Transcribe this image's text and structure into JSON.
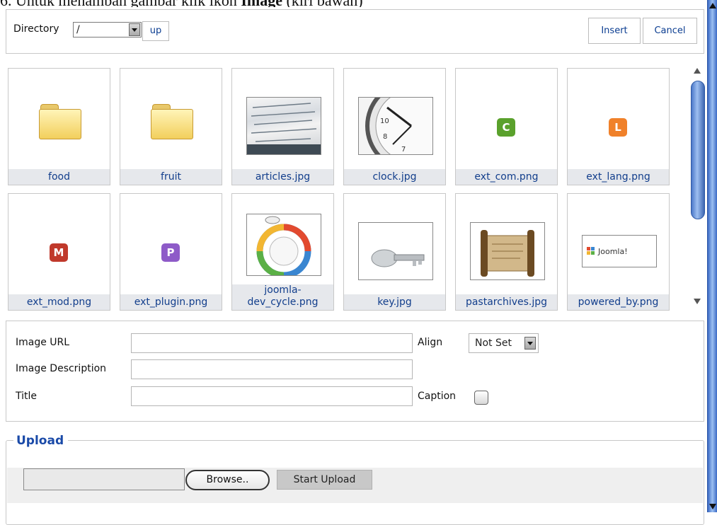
{
  "doc": {
    "prefix": "6.   Untuk menambah gambar klik ikon ",
    "bold": "Image",
    "suffix": " (kiri bawah)"
  },
  "toolbar": {
    "directory_label": "Directory",
    "directory_value": "/",
    "up_label": "up",
    "insert_label": "Insert",
    "cancel_label": "Cancel"
  },
  "files": [
    {
      "name": "food",
      "kind": "folder"
    },
    {
      "name": "fruit",
      "kind": "folder"
    },
    {
      "name": "articles.jpg",
      "kind": "photo",
      "icon": "articles-thumbnail"
    },
    {
      "name": "clock.jpg",
      "kind": "photo",
      "icon": "clock-thumbnail"
    },
    {
      "name": "ext_com.png",
      "kind": "badge",
      "letter": "C",
      "color": "#5aa12c"
    },
    {
      "name": "ext_lang.png",
      "kind": "badge",
      "letter": "L",
      "color": "#f0812a"
    },
    {
      "name": "ext_mod.png",
      "kind": "badge",
      "letter": "M",
      "color": "#c0392b"
    },
    {
      "name": "ext_plugin.png",
      "kind": "badge",
      "letter": "P",
      "color": "#8e5bc8"
    },
    {
      "name": "joomla-dev_cycle.png",
      "kind": "photo",
      "icon": "cycle-diagram-thumbnail"
    },
    {
      "name": "key.jpg",
      "kind": "photo",
      "icon": "key-thumbnail"
    },
    {
      "name": "pastarchives.jpg",
      "kind": "photo",
      "icon": "scroll-thumbnail"
    },
    {
      "name": "powered_by.png",
      "kind": "photo",
      "icon": "joomla-logo-thumbnail"
    }
  ],
  "thumb_text": {
    "powered_by": "Joomla!"
  },
  "form": {
    "image_url_label": "Image URL",
    "image_url_value": "",
    "description_label": "Image Description",
    "description_value": "",
    "title_label": "Title",
    "title_value": "",
    "align_label": "Align",
    "align_value": "Not Set",
    "caption_label": "Caption",
    "caption_checked": false
  },
  "upload": {
    "legend": "Upload",
    "browse_label": "Browse..",
    "start_label": "Start Upload"
  }
}
